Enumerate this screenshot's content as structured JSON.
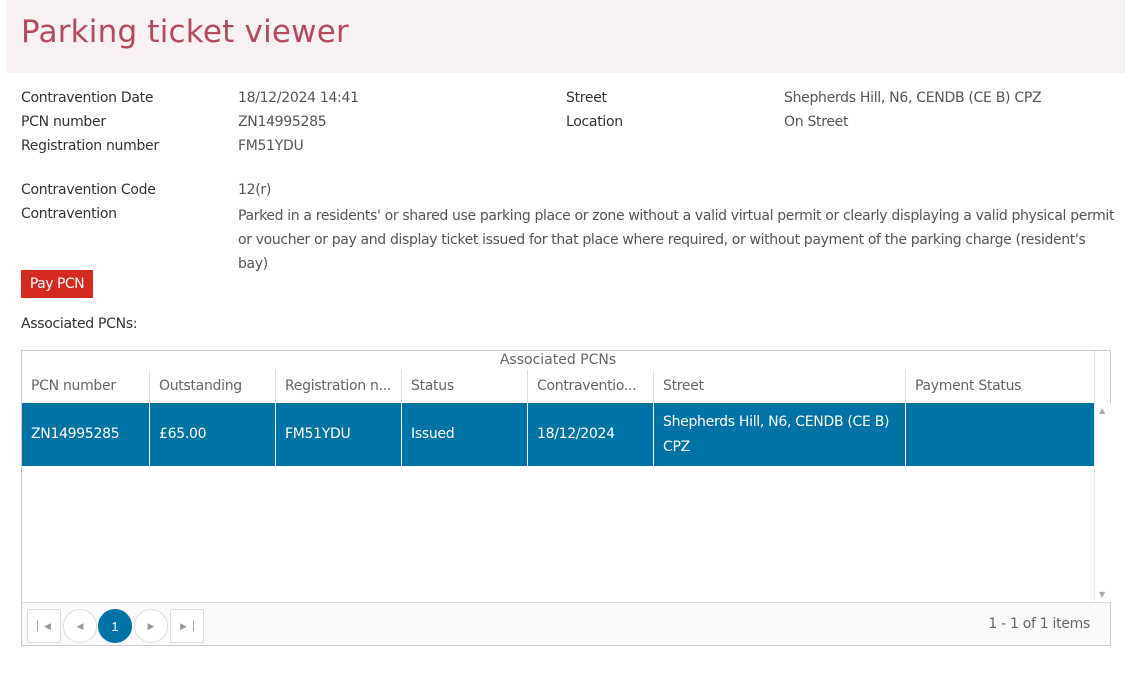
{
  "title": "Parking ticket viewer",
  "details": {
    "contravention_date_label": "Contravention Date",
    "contravention_date": "18/12/2024 14:41",
    "pcn_number_label": "PCN number",
    "pcn_number": "ZN14995285",
    "registration_label": "Registration number",
    "registration": "FM51YDU",
    "street_label": "Street",
    "street": "Shepherds Hill, N6, CENDB (CE B) CPZ",
    "location_label": "Location",
    "location": "On Street",
    "contravention_code_label": "Contravention Code",
    "contravention_code": "12(r)",
    "contravention_label": "Contravention",
    "contravention": "Parked in a residents' or shared use parking place or zone without a valid virtual permit or clearly displaying a valid physical permit or voucher or pay and display ticket issued for that place where required, or without payment of the parking charge (resident's bay)"
  },
  "pay_button": "Pay PCN",
  "associated_label": "Associated PCNs:",
  "grid": {
    "caption": "Associated PCNs",
    "columns": [
      "PCN number",
      "Outstanding",
      "Registration n...",
      "Status",
      "Contraventio...",
      "Street",
      "Payment Status"
    ],
    "rows": [
      {
        "pcn_number": "ZN14995285",
        "outstanding": "£65.00",
        "registration": "FM51YDU",
        "status": "Issued",
        "contravention_date": "18/12/2024",
        "street": "Shepherds Hill, N6, CENDB (CE B) CPZ",
        "payment_status": ""
      }
    ],
    "pager": {
      "current_page": "1",
      "info": "1 - 1 of 1 items"
    }
  },
  "colors": {
    "title": "#b5495e",
    "header_bg": "#f8f1f3",
    "pay_button": "#d52b1e",
    "selected_row": "#0073a6"
  },
  "icons": {
    "first_page": "seek-first-icon",
    "prev_page": "arrow-left-icon",
    "next_page": "arrow-right-icon",
    "last_page": "seek-last-icon"
  }
}
